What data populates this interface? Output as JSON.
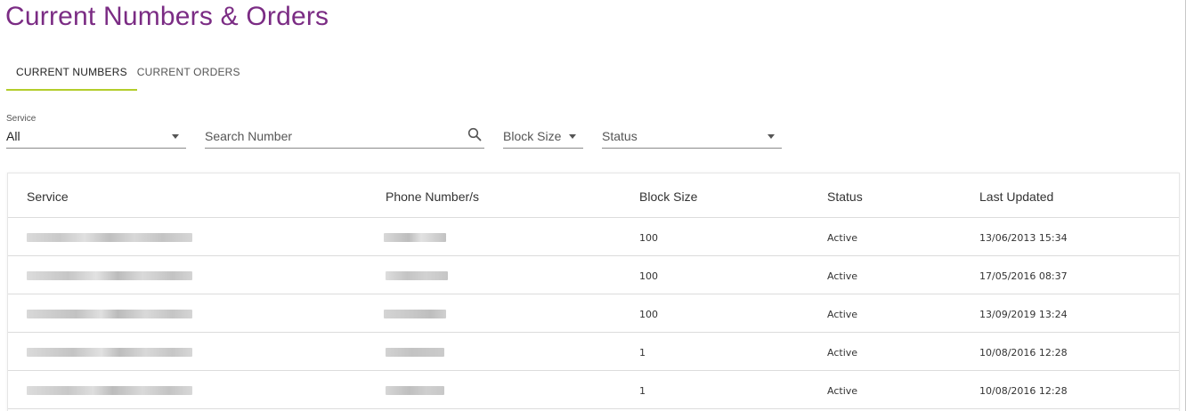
{
  "page": {
    "title": "Current Numbers & Orders"
  },
  "tabs": [
    {
      "label": "CURRENT NUMBERS",
      "active": true
    },
    {
      "label": "CURRENT ORDERS",
      "active": false
    }
  ],
  "filters": {
    "service": {
      "label": "Service",
      "value": "All"
    },
    "search": {
      "placeholder": "Search Number"
    },
    "block_size": {
      "placeholder": "Block Size"
    },
    "status": {
      "placeholder": "Status"
    }
  },
  "table": {
    "headers": {
      "service": "Service",
      "phone": "Phone Number/s",
      "block_size": "Block Size",
      "status": "Status",
      "last_updated": "Last Updated"
    },
    "rows": [
      {
        "block_size": "100",
        "status": "Active",
        "last_updated": "13/06/2013 15:34"
      },
      {
        "block_size": "100",
        "status": "Active",
        "last_updated": "17/05/2016 08:37"
      },
      {
        "block_size": "100",
        "status": "Active",
        "last_updated": "13/09/2019 13:24"
      },
      {
        "block_size": "1",
        "status": "Active",
        "last_updated": "10/08/2016 12:28"
      },
      {
        "block_size": "1",
        "status": "Active",
        "last_updated": "10/08/2016 12:28"
      }
    ]
  },
  "colors": {
    "title": "#7b2c84",
    "tab_indicator": "#b3cd2b"
  },
  "icons": {
    "search": "search-icon",
    "dropdown": "chevron-down-icon"
  }
}
